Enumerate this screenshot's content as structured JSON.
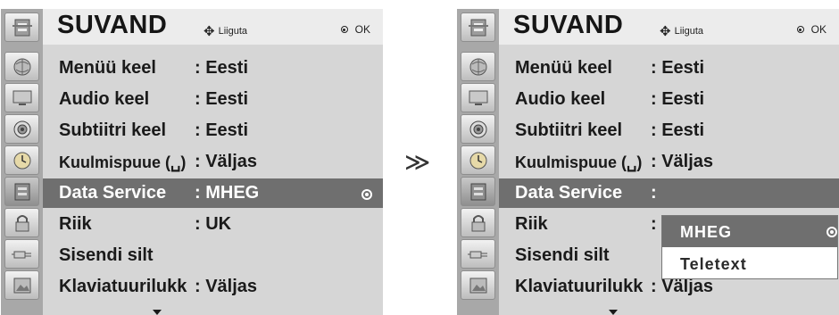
{
  "left_menu": {
    "title": "SUVAND",
    "nav_hint": "Liiguta",
    "ok_hint": "OK",
    "rows": [
      {
        "label": "Menüü keel",
        "value": ": Eesti"
      },
      {
        "label": "Audio keel",
        "value": ": Eesti"
      },
      {
        "label": "Subtiitri keel",
        "value": ": Eesti"
      },
      {
        "label": "Kuulmispuue (␣)",
        "value": ": Väljas"
      },
      {
        "label": "Data Service",
        "value": ": MHEG"
      },
      {
        "label": "Riik",
        "value": ": UK"
      },
      {
        "label": "Sisendi silt",
        "value": ""
      },
      {
        "label": "Klaviatuurilukk",
        "value": ": Väljas"
      }
    ]
  },
  "separator": "≫",
  "right_menu": {
    "title": "SUVAND",
    "nav_hint": "Liiguta",
    "ok_hint": "OK",
    "rows": [
      {
        "label": "Menüü keel",
        "value": ": Eesti"
      },
      {
        "label": "Audio keel",
        "value": ": Eesti"
      },
      {
        "label": "Subtiitri keel",
        "value": ": Eesti"
      },
      {
        "label": "Kuulmispuue (␣)",
        "value": ": Väljas"
      },
      {
        "label": "Data Service",
        "value": ":"
      },
      {
        "label": "Riik",
        "value": ":"
      },
      {
        "label": "Sisendi silt",
        "value": ""
      },
      {
        "label": "Klaviatuurilukk",
        "value": ": Väljas"
      }
    ]
  },
  "popup": {
    "options": [
      "MHEG",
      "Teletext"
    ],
    "selected": "MHEG"
  },
  "icons": [
    "globe-icon",
    "tv-icon",
    "speaker-icon",
    "clock-icon",
    "option-icon",
    "lock-icon",
    "input-plug-icon",
    "picture-icon"
  ],
  "colors": {
    "panel_bg": "#d6d6d6",
    "icon_column": "#a8a8a8",
    "header_bg": "#ececec",
    "highlight": "#6f6f6f"
  }
}
